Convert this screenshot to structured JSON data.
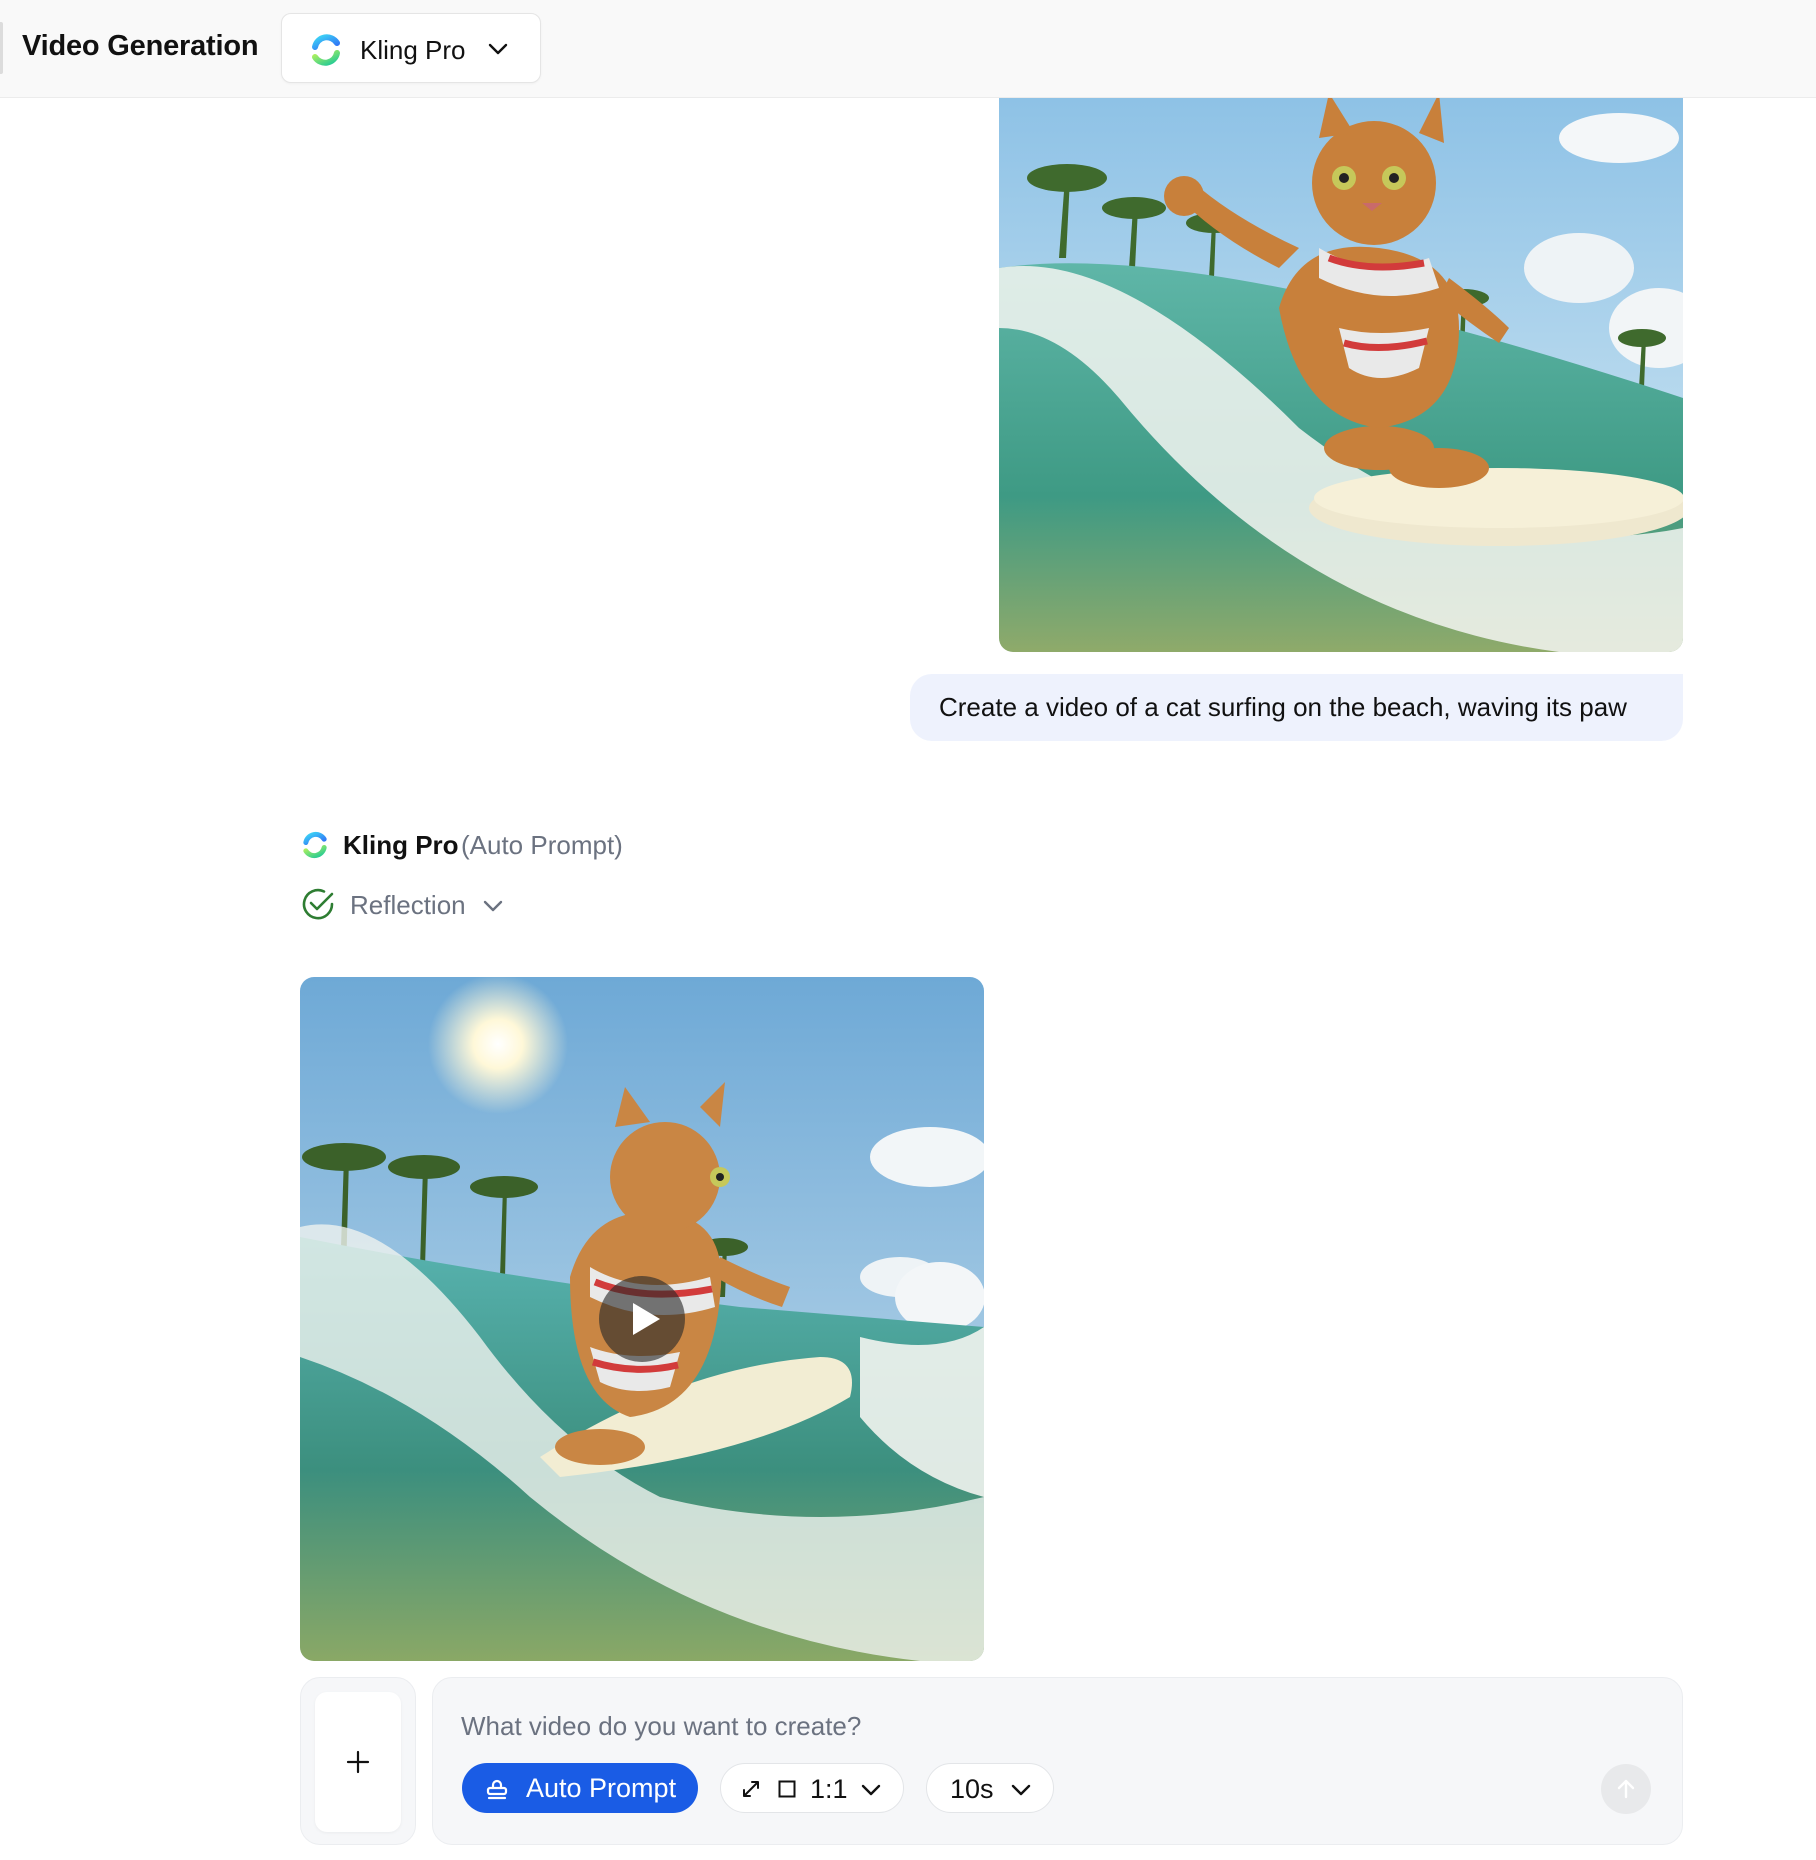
{
  "header": {
    "title": "Video Generation",
    "model_selector": {
      "label": "Kling Pro",
      "icon": "kling-logo-icon"
    }
  },
  "conversation": {
    "user_message": {
      "image": "cat-surfing-image",
      "text": "Create a video of a cat surfing on the beach, waving its paw"
    },
    "assistant": {
      "model": "Kling Pro",
      "mode": "(Auto Prompt)",
      "reflection_label": "Reflection",
      "reflection_status": "complete",
      "video": "cat-surfing-video"
    }
  },
  "composer": {
    "placeholder": "What video do you want to create?",
    "value": "",
    "auto_prompt_label": "Auto Prompt",
    "aspect_ratio": "1:1",
    "duration": "10s"
  },
  "colors": {
    "accent": "#1a5ce5",
    "user_bubble": "#eef2fd",
    "success": "#2e7d32"
  }
}
